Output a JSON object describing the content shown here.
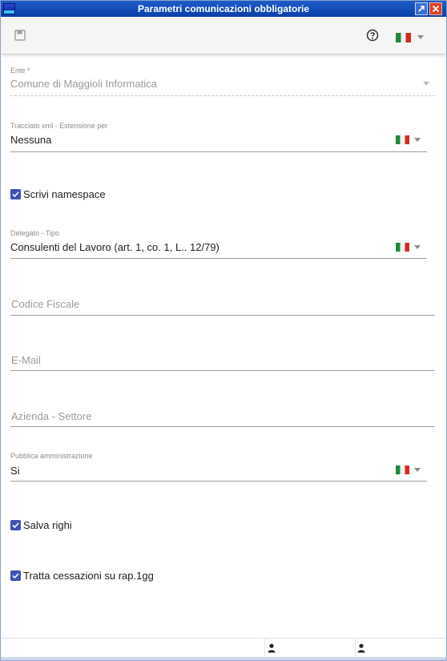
{
  "window": {
    "title": "Parametri comunicazioni obbligatorie"
  },
  "toolbar": {
    "save_icon": "save-icon",
    "help_icon": "help-icon",
    "language": "italian-flag"
  },
  "fields": {
    "ente": {
      "label": "Ente *",
      "value": "Comune di Maggioli Informatica"
    },
    "tracciato": {
      "label": "Tracciato xml - Estensione per",
      "value": "Nessuna"
    },
    "delegato": {
      "label": "Delegato - Tipo",
      "value": "Consulenti del Lavoro (art. 1, co. 1, L..  12/79)"
    },
    "codice_fiscale": {
      "placeholder": "Codice Fiscale"
    },
    "email": {
      "placeholder": "E-Mail"
    },
    "azienda": {
      "placeholder": "Azienda - Settore"
    },
    "pubblica": {
      "label": "Pubblica amministrazione",
      "value": "Si"
    }
  },
  "checkboxes": {
    "scrivi_namespace": {
      "label": "Scrivi namespace",
      "checked": true
    },
    "salva_righi": {
      "label": "Salva righi",
      "checked": true
    },
    "tratta_cessazioni": {
      "label": "Tratta cessazioni su rap.1gg",
      "checked": true
    }
  },
  "colors": {
    "titlebar": "#0a3fa8",
    "checkbox": "#3f51b5",
    "flag_green": "#1f8a3c",
    "flag_red": "#d52b1e"
  }
}
